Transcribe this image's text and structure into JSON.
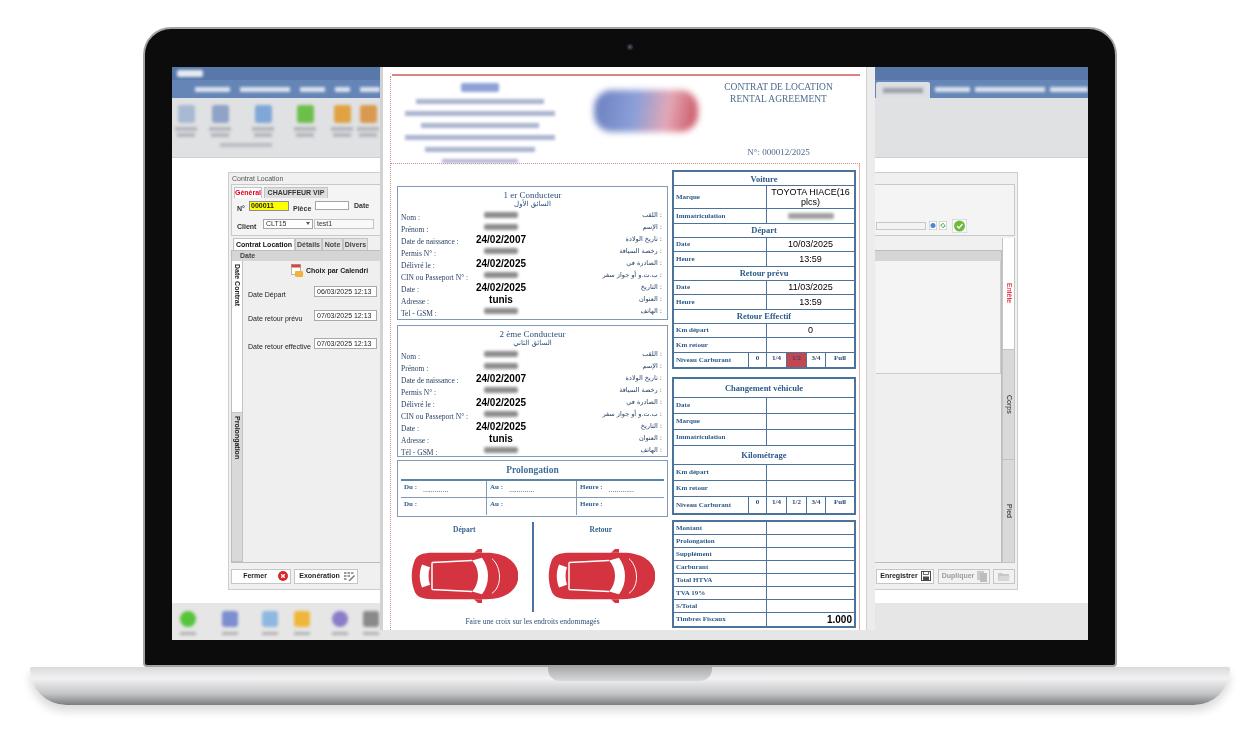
{
  "app": {
    "dialog_title": "Contrat Location",
    "header_tabs": [
      {
        "label": "Général",
        "selected": true
      },
      {
        "label": "CHAUFFEUR VIP",
        "selected": false
      }
    ],
    "number": {
      "label": "N°",
      "value": "000011"
    },
    "piece": {
      "label": "Pièce"
    },
    "date": {
      "label": "Date"
    },
    "client": {
      "label": "Client",
      "code": "CLT15",
      "name": "test1"
    },
    "tabs": [
      {
        "label": "Contrat Location",
        "selected": true
      },
      {
        "label": "Détails",
        "selected": false
      },
      {
        "label": "Note",
        "selected": false
      },
      {
        "label": "Divers",
        "selected": false
      }
    ],
    "panel_header": "Date",
    "side_tabs": [
      {
        "label": "Date Contrat",
        "selected": true
      },
      {
        "label": "Prolongation",
        "selected": false
      }
    ],
    "calendar_button": "Choix par Calendri",
    "date_fields": [
      {
        "label": "Date Départ",
        "value": "06/03/2025 12:13"
      },
      {
        "label": "Date retour prévu",
        "value": "07/03/2025 12:13"
      },
      {
        "label": "Date retour effective",
        "value": "07/03/2025 12:13"
      }
    ],
    "right_tabs": [
      {
        "label": "Entête",
        "selected": true
      },
      {
        "label": "Corps",
        "selected": false
      },
      {
        "label": "Pied",
        "selected": false
      }
    ],
    "left_buttons": [
      {
        "label": "Fermer",
        "kind": "close",
        "disabled": false
      },
      {
        "label": "Exonération",
        "kind": "grid",
        "disabled": false
      }
    ],
    "right_buttons": [
      {
        "label": "Enregistrer",
        "kind": "save",
        "disabled": false
      },
      {
        "label": "Dupliquer",
        "kind": "copy",
        "disabled": true
      },
      {
        "kind": "folder",
        "disabled": true
      }
    ]
  },
  "document": {
    "title": "CONTRAT DE LOCATION",
    "subtitle": "RENTAL AGREEMENT",
    "number": "N°: 000012/2025",
    "drivers": [
      {
        "title": "1 er Conducteur",
        "title_ar": "السائق الأول",
        "rows": [
          {
            "label": "Nom :",
            "label_ar": "اللقب :",
            "blurred": true
          },
          {
            "label": "Prénom :",
            "label_ar": "الإسم :",
            "blurred": true
          },
          {
            "label": "Date de naissance :",
            "label_ar": "تاريخ الولادة :",
            "value": "24/02/2007"
          },
          {
            "label": "Permis N° :",
            "label_ar": "رخصة السياقة :",
            "blurred": true
          },
          {
            "label": "Délivré le :",
            "label_ar": "الصادرة في :",
            "value": "24/02/2025"
          },
          {
            "label": "CIN ou Passeport N° :",
            "label_ar": "ب.ت.و أو جواز سفر :",
            "blurred": true
          },
          {
            "label": "Date :",
            "label_ar": "التاريخ :",
            "value": "24/02/2025"
          },
          {
            "label": "Adresse :",
            "label_ar": "العنوان :",
            "value": "tunis"
          },
          {
            "label": "Tel - GSM :",
            "label_ar": "الهاتف :",
            "blurred": true
          }
        ]
      },
      {
        "title": "2 ème Conducteur",
        "title_ar": "السائق الثاني",
        "rows": [
          {
            "label": "Nom :",
            "label_ar": "اللقب :",
            "blurred": true
          },
          {
            "label": "Prénom :",
            "label_ar": "الإسم :",
            "blurred": true
          },
          {
            "label": "Date de naissance :",
            "label_ar": "تاريخ الولادة :",
            "value": "24/02/2007"
          },
          {
            "label": "Permis N° :",
            "label_ar": "رخصة السياقة :",
            "blurred": true
          },
          {
            "label": "Délivré le :",
            "label_ar": "الصادرة في :",
            "value": "24/02/2025"
          },
          {
            "label": "CIN ou Passeport N° :",
            "label_ar": "ب.ت.و أو جواز سفر :",
            "blurred": true
          },
          {
            "label": "Date :",
            "label_ar": "التاريخ :",
            "value": "24/02/2025"
          },
          {
            "label": "Adresse :",
            "label_ar": "العنوان :",
            "value": "tunis"
          },
          {
            "label": "Tél - GSM :",
            "label_ar": "الهاتف :",
            "blurred": true
          }
        ]
      }
    ],
    "prolongation": {
      "title": "Prolongation",
      "rows": [
        {
          "cells": [
            {
              "label": "Du :",
              "value": "............."
            },
            {
              "label": "Au :",
              "value": "............."
            },
            {
              "label": "Heure :",
              "value": "............."
            }
          ]
        },
        {
          "cells": [
            {
              "label": "Du :"
            },
            {
              "label": "Au :"
            },
            {
              "label": "Heure :"
            }
          ]
        }
      ]
    },
    "damage": {
      "columns": [
        {
          "label": "Départ"
        },
        {
          "label": "Retour"
        }
      ],
      "note": "Faire une croix sur les endroits endommagés"
    },
    "vehicle_table": {
      "sections": [
        {
          "title": "Voiture",
          "rows": [
            {
              "label": "Marque",
              "value": "TOYOTA HIACE(16 plcs)"
            },
            {
              "label": "Immatriculation",
              "blurred": true
            }
          ]
        },
        {
          "title": "Départ",
          "rows": [
            {
              "label": "Date",
              "value": "10/03/2025"
            },
            {
              "label": "Heure",
              "value": "13:59"
            }
          ]
        },
        {
          "title": "Retour prévu",
          "rows": [
            {
              "label": "Date",
              "value": "11/03/2025"
            },
            {
              "label": "Heure",
              "value": "13:59"
            }
          ]
        },
        {
          "title": "Retour Effectif",
          "rows": [
            {
              "label": "Km départ",
              "value": "0"
            },
            {
              "label": "Km retour"
            }
          ]
        }
      ],
      "fuel": {
        "label": "Niveau Carburant",
        "levels": [
          {
            "label": "0",
            "selected": false
          },
          {
            "label": "1/4",
            "selected": false
          },
          {
            "label": "1/2",
            "selected": true
          },
          {
            "label": "3/4",
            "selected": false
          },
          {
            "label": "Full",
            "selected": false
          }
        ]
      }
    },
    "change_table": {
      "sections": [
        {
          "title": "Changement véhicule",
          "rows": [
            {
              "label": "Date"
            },
            {
              "label": "Marque"
            },
            {
              "label": "Immatriculation"
            }
          ]
        },
        {
          "title": "Kilométrage",
          "rows": [
            {
              "label": "Km départ"
            },
            {
              "label": "Km retour"
            }
          ]
        }
      ],
      "fuel": {
        "label": "Niveau Carburant",
        "levels": [
          {
            "label": "0",
            "selected": false
          },
          {
            "label": "1/4",
            "selected": false
          },
          {
            "label": "1/2",
            "selected": false
          },
          {
            "label": "3/4",
            "selected": false
          },
          {
            "label": "Full",
            "selected": false
          }
        ]
      }
    },
    "totals": [
      {
        "label": "Montant"
      },
      {
        "label": "Prolongation"
      },
      {
        "label": "Supplément"
      },
      {
        "label": "Carburant"
      },
      {
        "label": "Total HTVA"
      },
      {
        "label": "TVA 19%"
      },
      {
        "label": "S/Total"
      },
      {
        "label": "Timbres Fiscaux",
        "value": "1.000"
      }
    ]
  }
}
